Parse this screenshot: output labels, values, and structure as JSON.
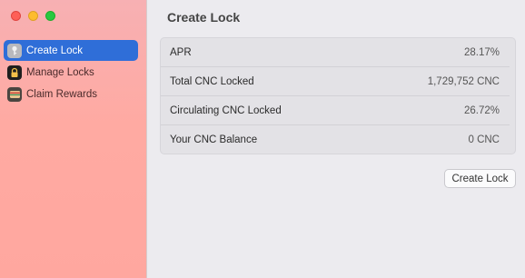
{
  "window": {
    "traffic_lights": [
      "close",
      "minimize",
      "zoom"
    ]
  },
  "sidebar": {
    "items": [
      {
        "label": "Create Lock",
        "icon": "key-icon",
        "active": true
      },
      {
        "label": "Manage Locks",
        "icon": "lock-icon",
        "active": false
      },
      {
        "label": "Claim Rewards",
        "icon": "wallet-icon",
        "active": false
      }
    ]
  },
  "main": {
    "title": "Create Lock",
    "stats": [
      {
        "label": "APR",
        "value": "28.17%"
      },
      {
        "label": "Total CNC Locked",
        "value": "1,729,752 CNC"
      },
      {
        "label": "Circulating CNC Locked",
        "value": "26.72%"
      },
      {
        "label": "Your CNC Balance",
        "value": "0 CNC"
      }
    ],
    "button_label": "Create Lock"
  },
  "colors": {
    "accent": "#2f6ed8",
    "sidebar_bg": "#ffaaa2"
  }
}
